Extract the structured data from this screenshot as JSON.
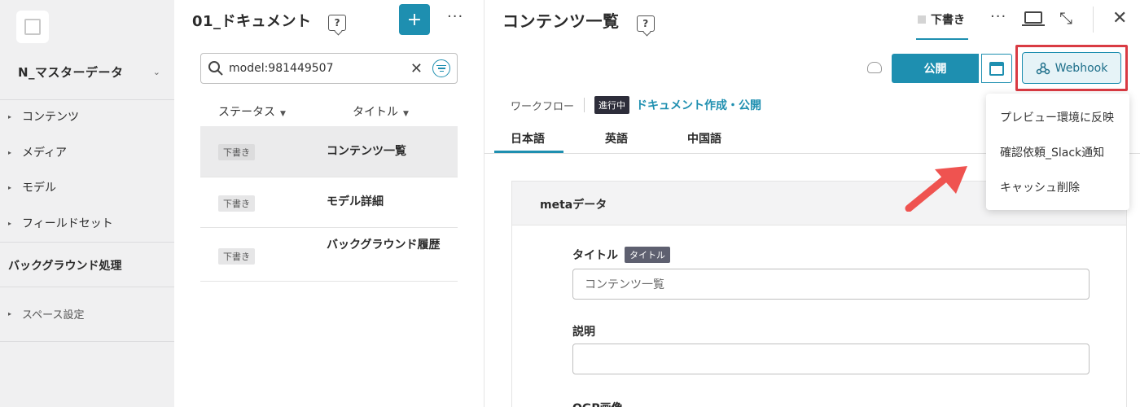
{
  "sidebar": {
    "project_name": "N_マスターデータ",
    "items": [
      {
        "label": "コンテンツ"
      },
      {
        "label": "メディア"
      },
      {
        "label": "モデル"
      },
      {
        "label": "フィールドセット"
      }
    ],
    "background_processing": "バックグラウンド処理",
    "space_settings": "スペース設定"
  },
  "list_panel": {
    "title": "01_ドキュメント",
    "search_value": "model:981449507",
    "columns": [
      "ステータス",
      "タイトル"
    ],
    "rows": [
      {
        "status": "下書き",
        "title": "コンテンツ一覧",
        "selected": true
      },
      {
        "status": "下書き",
        "title": "モデル詳細",
        "selected": false
      },
      {
        "status": "下書き",
        "title": "バックグラウンド履歴",
        "selected": false
      }
    ]
  },
  "main": {
    "title": "コンテンツ一覧",
    "draft_tab": "下書き",
    "publish_label": "公開",
    "webhook_label": "Webhook",
    "workflow": {
      "label": "ワークフロー",
      "badge": "進行中",
      "link": "ドキュメント作成・公開"
    },
    "lang_tabs": [
      "日本語",
      "英語",
      "中国語"
    ],
    "card": {
      "title": "metaデータ",
      "fields": [
        {
          "label": "タイトル",
          "badge": "タイトル",
          "value": "コンテンツ一覧"
        },
        {
          "label": "説明",
          "value": ""
        },
        {
          "label": "OGP画像"
        }
      ]
    }
  },
  "webhook_menu": {
    "items": [
      "プレビュー環境に反映",
      "確認依頼_Slack通知",
      "キャッシュ削除"
    ]
  },
  "colors": {
    "accent": "#1e8fb0",
    "highlight": "#d93b43",
    "arrow": "#ef5350"
  }
}
